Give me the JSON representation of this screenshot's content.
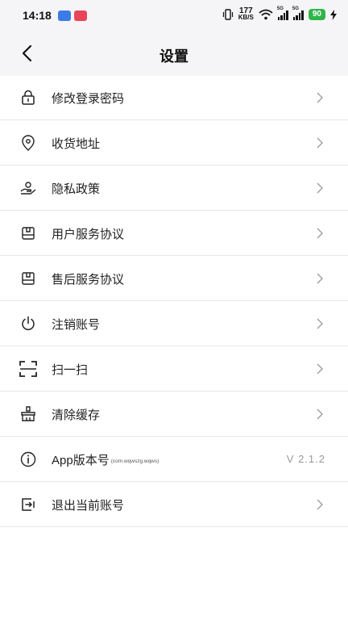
{
  "status_bar": {
    "time": "14:18",
    "net_speed_value": "177",
    "net_speed_unit": "KB/S",
    "sim1_label": "5G",
    "sim2_label": "5G",
    "battery": "90"
  },
  "header": {
    "title": "设置"
  },
  "settings": {
    "items": [
      {
        "label": "修改登录密码",
        "icon": "lock-icon"
      },
      {
        "label": "收货地址",
        "icon": "location-icon"
      },
      {
        "label": "隐私政策",
        "icon": "privacy-hand-icon"
      },
      {
        "label": "用户服务协议",
        "icon": "agreement-icon"
      },
      {
        "label": "售后服务协议",
        "icon": "agreement-icon"
      },
      {
        "label": "注销账号",
        "icon": "power-icon"
      },
      {
        "label": "扫一扫",
        "icon": "scan-icon"
      },
      {
        "label": "清除缓存",
        "icon": "broom-icon"
      },
      {
        "label": "App版本号",
        "sublabel": "(com.wqwszg.wqws)",
        "value": "V 2.1.2",
        "icon": "info-icon"
      },
      {
        "label": "退出当前账号",
        "icon": "logout-icon"
      }
    ]
  },
  "colors": {
    "status_bg": "#f5f5f7",
    "battery": "#2fb54a",
    "divider": "#e8e8e8"
  }
}
